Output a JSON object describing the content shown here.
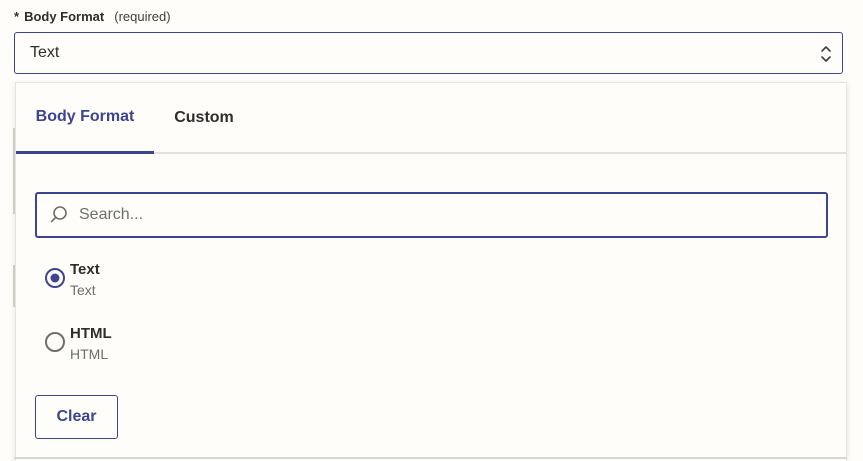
{
  "field": {
    "required_marker": "*",
    "label": "Body Format",
    "required_note": "(required)",
    "selected_value": "Text"
  },
  "popover": {
    "tabs": [
      {
        "label": "Body Format",
        "active": true
      },
      {
        "label": "Custom",
        "active": false
      }
    ],
    "search": {
      "placeholder": "Search...",
      "value": ""
    },
    "options": [
      {
        "title": "Text",
        "subtitle": "Text",
        "selected": true
      },
      {
        "title": "HTML",
        "subtitle": "HTML",
        "selected": false
      }
    ],
    "clear_label": "Clear"
  },
  "colors": {
    "accent": "#3d4592",
    "background": "#fffdf9",
    "text": "#2d2e2e",
    "muted": "#6f6e6b"
  },
  "icons": [
    "chevron-up-down-icon",
    "search-icon",
    "radio-selected-icon",
    "radio-unselected-icon"
  ]
}
